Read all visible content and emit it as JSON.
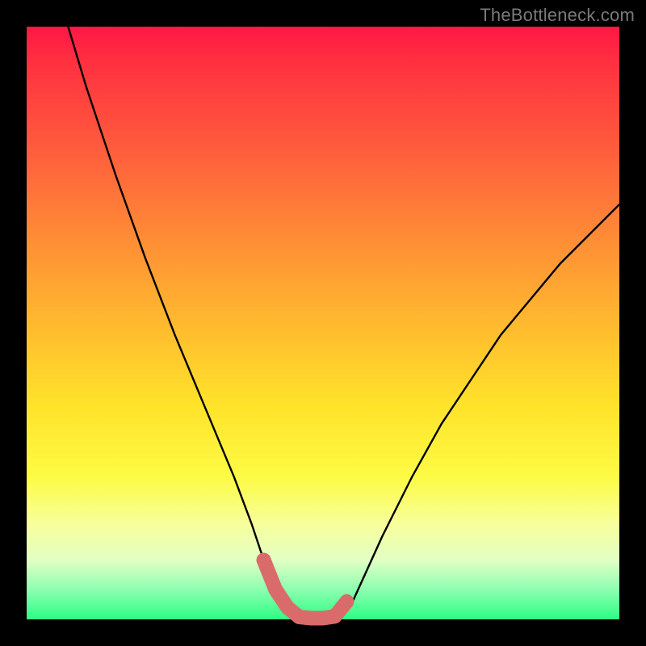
{
  "watermark": "TheBottleneck.com",
  "chart_data": {
    "type": "line",
    "title": "",
    "xlabel": "",
    "ylabel": "",
    "xlim": [
      0,
      100
    ],
    "ylim": [
      0,
      100
    ],
    "series": [
      {
        "name": "curve",
        "color": "#000000",
        "x": [
          7,
          10,
          15,
          20,
          25,
          30,
          35,
          38,
          40,
          42,
          44,
          46,
          48,
          50,
          52,
          55,
          60,
          65,
          70,
          80,
          90,
          100
        ],
        "y": [
          100,
          90,
          75,
          61,
          48,
          36,
          24,
          16,
          10,
          5,
          2,
          0.4,
          0.2,
          0.2,
          0.5,
          3,
          14,
          24,
          33,
          48,
          60,
          70
        ]
      },
      {
        "name": "highlight-band",
        "color": "#d96b6b",
        "x": [
          40,
          42,
          44,
          46,
          48,
          50,
          52,
          54
        ],
        "y": [
          10,
          5,
          2,
          0.4,
          0.2,
          0.2,
          0.5,
          3
        ]
      }
    ],
    "gradient_stops": [
      {
        "pos": 0,
        "color": "#ff1745"
      },
      {
        "pos": 20,
        "color": "#ff5a3d"
      },
      {
        "pos": 50,
        "color": "#ffb92f"
      },
      {
        "pos": 76,
        "color": "#fdfb45"
      },
      {
        "pos": 100,
        "color": "#2dfd84"
      }
    ]
  }
}
